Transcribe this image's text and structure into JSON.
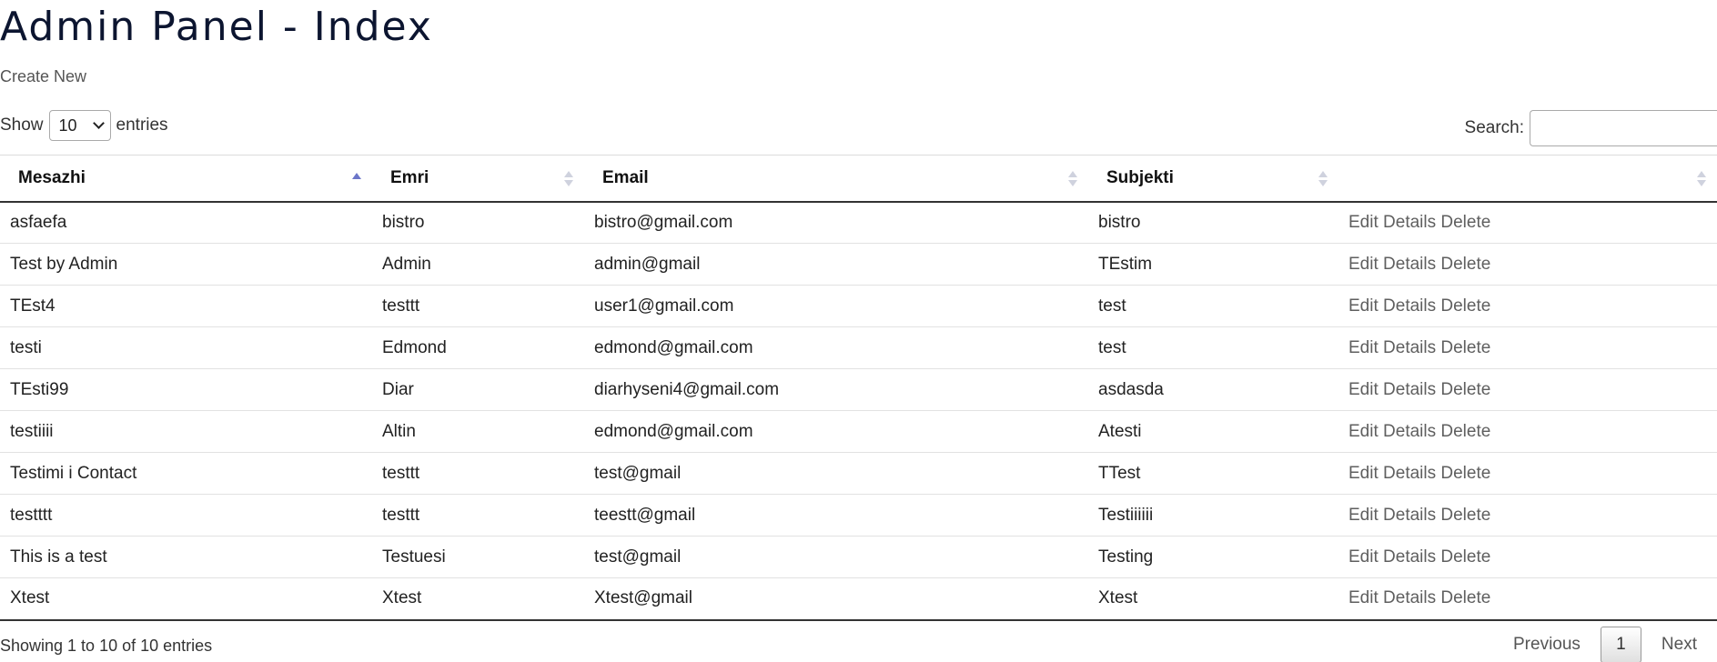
{
  "page": {
    "title": "Admin Panel - Index",
    "create_label": "Create New"
  },
  "length": {
    "prefix": "Show",
    "value": "10",
    "suffix": "entries"
  },
  "search": {
    "label": "Search:",
    "value": ""
  },
  "table": {
    "headers": [
      "Mesazhi",
      "Emri",
      "Email",
      "Subjekti",
      ""
    ],
    "sort_active_column": "Mesazhi",
    "rows": [
      {
        "mesazhi": "asfaefa",
        "emri": "bistro",
        "email": "bistro@gmail.com",
        "subjekti": "bistro"
      },
      {
        "mesazhi": "Test by Admin",
        "emri": "Admin",
        "email": "admin@gmail",
        "subjekti": "TEstim"
      },
      {
        "mesazhi": "TEst4",
        "emri": "testtt",
        "email": "user1@gmail.com",
        "subjekti": "test"
      },
      {
        "mesazhi": "testi",
        "emri": "Edmond",
        "email": "edmond@gmail.com",
        "subjekti": "test"
      },
      {
        "mesazhi": "TEsti99",
        "emri": "Diar",
        "email": "diarhyseni4@gmail.com",
        "subjekti": "asdasda"
      },
      {
        "mesazhi": "testiiii",
        "emri": "Altin",
        "email": "edmond@gmail.com",
        "subjekti": "Atesti"
      },
      {
        "mesazhi": "Testimi i Contact",
        "emri": "testtt",
        "email": "test@gmail",
        "subjekti": "TTest"
      },
      {
        "mesazhi": "testttt",
        "emri": "testtt",
        "email": "teestt@gmail",
        "subjekti": "Testiiiiii"
      },
      {
        "mesazhi": "This is a test",
        "emri": "Testuesi",
        "email": "test@gmail",
        "subjekti": "Testing"
      },
      {
        "mesazhi": "Xtest",
        "emri": "Xtest",
        "email": "Xtest@gmail",
        "subjekti": "Xtest"
      }
    ],
    "actions": {
      "edit": "Edit",
      "details": "Details",
      "delete": "Delete"
    }
  },
  "footer": {
    "info": "Showing 1 to 10 of 10 entries",
    "previous": "Previous",
    "current_page": "1",
    "next": "Next"
  },
  "colors": {
    "title": "#0c1530",
    "sort_active": "#6c76c9",
    "sort_inactive": "#cfd2de",
    "link": "#5f5f5f"
  }
}
